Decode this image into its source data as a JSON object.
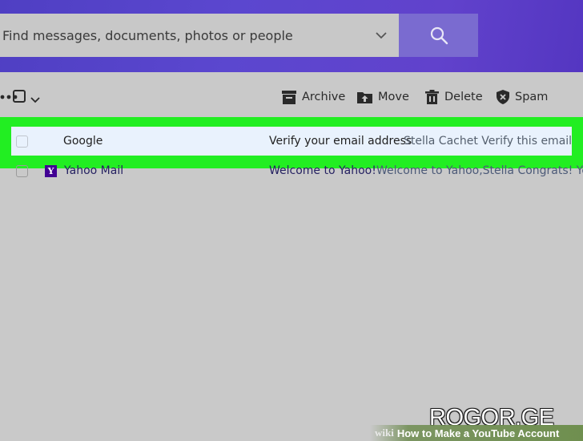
{
  "search": {
    "placeholder": "Find messages, documents, photos or people"
  },
  "toolbar": {
    "archive_label": "Archive",
    "move_label": "Move",
    "delete_label": "Delete",
    "spam_label": "Spam"
  },
  "messages": [
    {
      "sender": "Google",
      "subject": "Verify your email address",
      "snippet": "Stella Cachet Verify this email is y",
      "selected": true
    },
    {
      "sender": "Yahoo Mail",
      "sender_icon": "Y",
      "subject": "Welcome to Yahoo!",
      "snippet": "Welcome to Yahoo,Stella Congrats! Your"
    }
  ],
  "watermark": {
    "brand": "ROGOR.GE",
    "wiki": "wiki",
    "title": "How to Make a YouTube Account"
  },
  "colors": {
    "header_gradient": "#5b47cf",
    "search_button": "#7a6bd0",
    "highlight": "#22ee22",
    "selected_row": "#e9f2fd",
    "page_background": "#c9c9c9"
  },
  "icons": [
    "chevron-down-icon",
    "search-icon",
    "archive-icon",
    "move-icon",
    "trash-icon",
    "shield-icon",
    "more-icon",
    "yahoo-logo-icon"
  ]
}
